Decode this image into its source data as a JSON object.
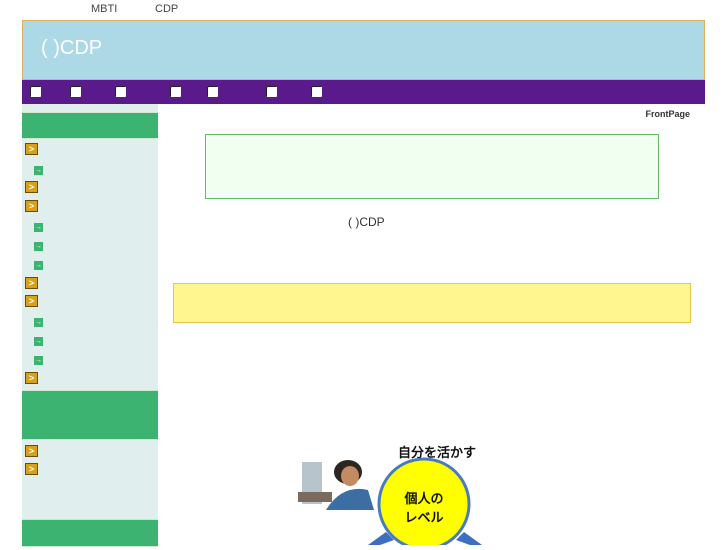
{
  "top_links": [
    "MBTI",
    "CDP"
  ],
  "header": {
    "title": "( )CDP"
  },
  "nav": {
    "items": [
      "",
      "",
      "",
      "",
      "",
      "",
      ""
    ]
  },
  "breadcrumb": "FrontPage",
  "main": {
    "title": "( )CDP"
  },
  "sidebar": {
    "section1_icons": [
      "folder",
      "page",
      "folder",
      "folder",
      "page",
      "page",
      "page",
      "folder",
      "folder",
      "page",
      "page",
      "page",
      "folder"
    ],
    "section2_icons": [
      "folder",
      "folder"
    ]
  },
  "diagram": {
    "caption": "自分を活かす",
    "circle_label_line1": "個人の",
    "circle_label_line2": "レベル"
  },
  "colors": {
    "header_bg": "#add8e6",
    "nav_bg": "#5b1a8c",
    "sidebar_bg": "#e0eeee",
    "sidebar_head": "#3cb371",
    "circle_fill": "#ffff00"
  }
}
